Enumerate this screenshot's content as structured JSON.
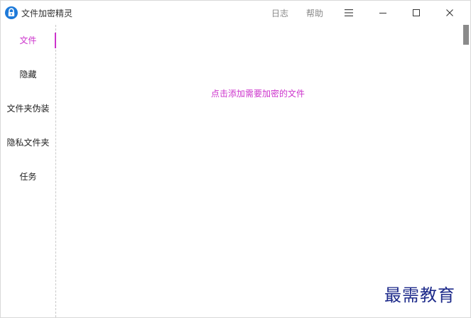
{
  "app": {
    "title": "文件加密精灵",
    "icon": "padlock-icon",
    "accent_color": "#cc33cc"
  },
  "titlebar": {
    "log_label": "日志",
    "help_label": "帮助",
    "menu_icon": "hamburger-menu-icon",
    "minimize_icon": "minimize-icon",
    "maximize_icon": "maximize-icon",
    "close_icon": "close-icon"
  },
  "sidebar": {
    "items": [
      {
        "label": "文件",
        "active": true
      },
      {
        "label": "隐藏",
        "active": false
      },
      {
        "label": "文件夹伪装",
        "active": false
      },
      {
        "label": "隐私文件夹",
        "active": false
      },
      {
        "label": "任务",
        "active": false
      }
    ]
  },
  "main": {
    "hint": "点击添加需要加密的文件"
  },
  "watermark": {
    "text": "最需教育",
    "color": "#1d2a8a"
  }
}
